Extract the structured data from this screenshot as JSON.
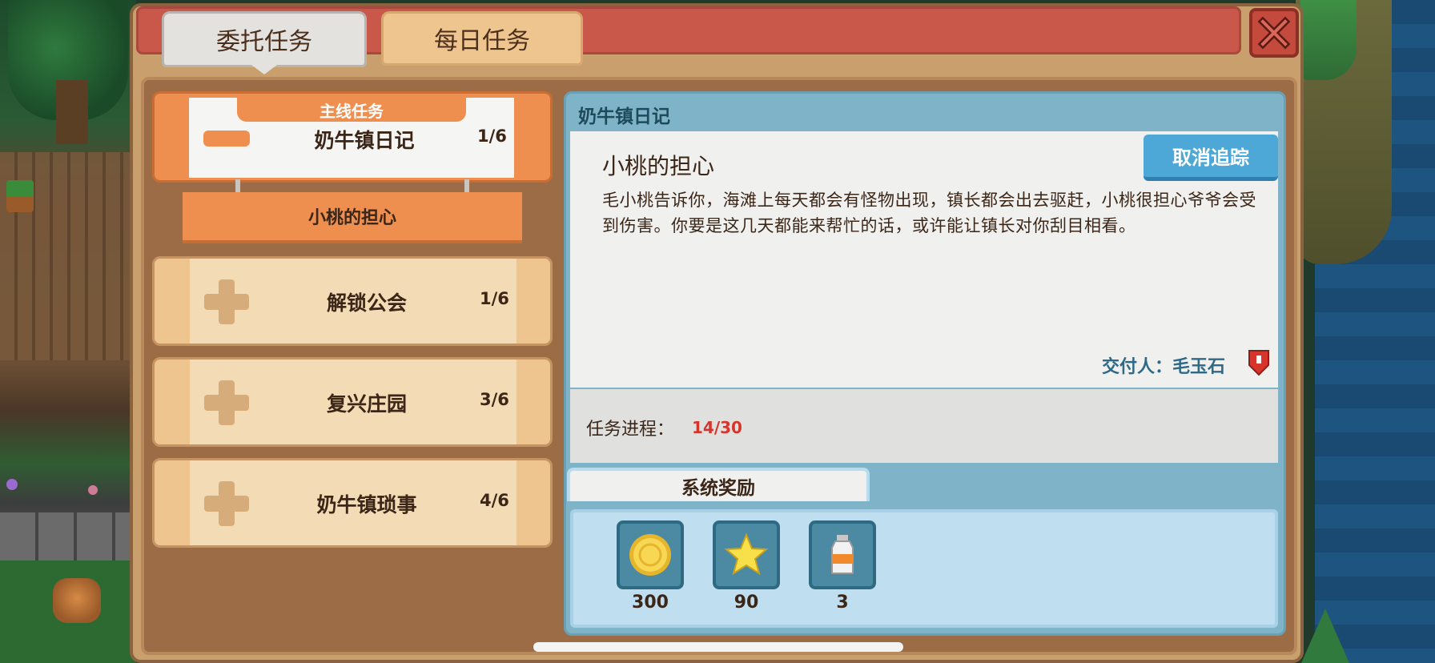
{
  "tabs": {
    "active": "委托任务",
    "inactive": "每日任务"
  },
  "quest_list": {
    "main_group": {
      "tag": "主线任务",
      "title": "奶牛镇日记",
      "count": "1/6",
      "sub_item": "小桃的担心"
    },
    "items": [
      {
        "title": "解锁公会",
        "count": "1/6"
      },
      {
        "title": "复兴庄园",
        "count": "3/6"
      },
      {
        "title": "奶牛镇琐事",
        "count": "4/6"
      }
    ]
  },
  "detail": {
    "header": "奶牛镇日记",
    "subtitle": "小桃的担心",
    "cancel_button": "取消追踪",
    "description": "毛小桃告诉你，海滩上每天都会有怪物出现，镇长都会出去驱赶，小桃很担心爷爷会受到伤害。你要是这几天都能来帮忙的话，或许能让镇长对你刮目相看。",
    "giver": "交付人：毛玉石",
    "progress_label": "任务进程：",
    "progress_value": "14/30",
    "progress": {
      "current": 14,
      "total": 30
    }
  },
  "rewards": {
    "tab_label": "系统奖励",
    "items": [
      {
        "icon": "gold-coin-icon",
        "qty": "300"
      },
      {
        "icon": "star-icon",
        "qty": "90"
      },
      {
        "icon": "milk-bottle-icon",
        "qty": "3"
      }
    ]
  },
  "colors": {
    "accent_orange": "#ef8f4f",
    "progress_red": "#d7352b",
    "button_blue": "#4da7d7"
  }
}
